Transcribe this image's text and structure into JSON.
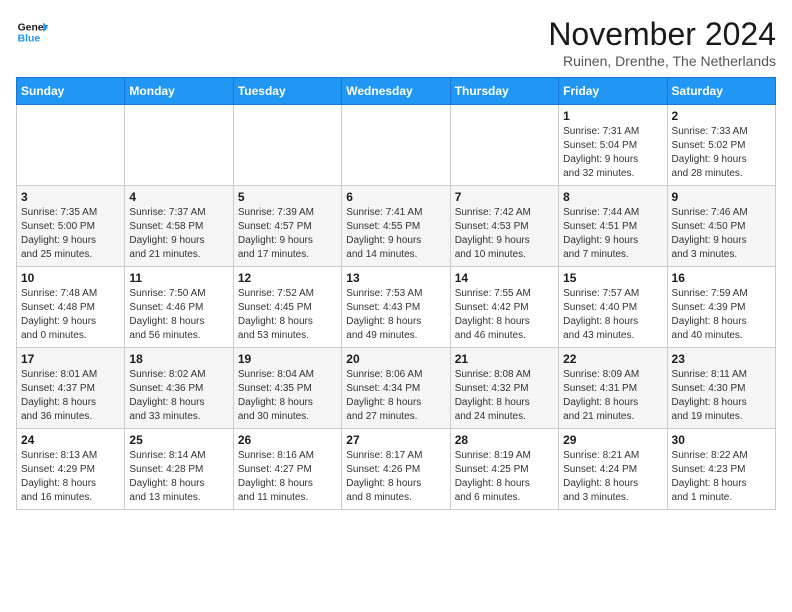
{
  "header": {
    "logo_line1": "General",
    "logo_line2": "Blue",
    "month": "November 2024",
    "location": "Ruinen, Drenthe, The Netherlands"
  },
  "weekdays": [
    "Sunday",
    "Monday",
    "Tuesday",
    "Wednesday",
    "Thursday",
    "Friday",
    "Saturday"
  ],
  "weeks": [
    [
      {
        "day": "",
        "info": ""
      },
      {
        "day": "",
        "info": ""
      },
      {
        "day": "",
        "info": ""
      },
      {
        "day": "",
        "info": ""
      },
      {
        "day": "",
        "info": ""
      },
      {
        "day": "1",
        "info": "Sunrise: 7:31 AM\nSunset: 5:04 PM\nDaylight: 9 hours\nand 32 minutes."
      },
      {
        "day": "2",
        "info": "Sunrise: 7:33 AM\nSunset: 5:02 PM\nDaylight: 9 hours\nand 28 minutes."
      }
    ],
    [
      {
        "day": "3",
        "info": "Sunrise: 7:35 AM\nSunset: 5:00 PM\nDaylight: 9 hours\nand 25 minutes."
      },
      {
        "day": "4",
        "info": "Sunrise: 7:37 AM\nSunset: 4:58 PM\nDaylight: 9 hours\nand 21 minutes."
      },
      {
        "day": "5",
        "info": "Sunrise: 7:39 AM\nSunset: 4:57 PM\nDaylight: 9 hours\nand 17 minutes."
      },
      {
        "day": "6",
        "info": "Sunrise: 7:41 AM\nSunset: 4:55 PM\nDaylight: 9 hours\nand 14 minutes."
      },
      {
        "day": "7",
        "info": "Sunrise: 7:42 AM\nSunset: 4:53 PM\nDaylight: 9 hours\nand 10 minutes."
      },
      {
        "day": "8",
        "info": "Sunrise: 7:44 AM\nSunset: 4:51 PM\nDaylight: 9 hours\nand 7 minutes."
      },
      {
        "day": "9",
        "info": "Sunrise: 7:46 AM\nSunset: 4:50 PM\nDaylight: 9 hours\nand 3 minutes."
      }
    ],
    [
      {
        "day": "10",
        "info": "Sunrise: 7:48 AM\nSunset: 4:48 PM\nDaylight: 9 hours\nand 0 minutes."
      },
      {
        "day": "11",
        "info": "Sunrise: 7:50 AM\nSunset: 4:46 PM\nDaylight: 8 hours\nand 56 minutes."
      },
      {
        "day": "12",
        "info": "Sunrise: 7:52 AM\nSunset: 4:45 PM\nDaylight: 8 hours\nand 53 minutes."
      },
      {
        "day": "13",
        "info": "Sunrise: 7:53 AM\nSunset: 4:43 PM\nDaylight: 8 hours\nand 49 minutes."
      },
      {
        "day": "14",
        "info": "Sunrise: 7:55 AM\nSunset: 4:42 PM\nDaylight: 8 hours\nand 46 minutes."
      },
      {
        "day": "15",
        "info": "Sunrise: 7:57 AM\nSunset: 4:40 PM\nDaylight: 8 hours\nand 43 minutes."
      },
      {
        "day": "16",
        "info": "Sunrise: 7:59 AM\nSunset: 4:39 PM\nDaylight: 8 hours\nand 40 minutes."
      }
    ],
    [
      {
        "day": "17",
        "info": "Sunrise: 8:01 AM\nSunset: 4:37 PM\nDaylight: 8 hours\nand 36 minutes."
      },
      {
        "day": "18",
        "info": "Sunrise: 8:02 AM\nSunset: 4:36 PM\nDaylight: 8 hours\nand 33 minutes."
      },
      {
        "day": "19",
        "info": "Sunrise: 8:04 AM\nSunset: 4:35 PM\nDaylight: 8 hours\nand 30 minutes."
      },
      {
        "day": "20",
        "info": "Sunrise: 8:06 AM\nSunset: 4:34 PM\nDaylight: 8 hours\nand 27 minutes."
      },
      {
        "day": "21",
        "info": "Sunrise: 8:08 AM\nSunset: 4:32 PM\nDaylight: 8 hours\nand 24 minutes."
      },
      {
        "day": "22",
        "info": "Sunrise: 8:09 AM\nSunset: 4:31 PM\nDaylight: 8 hours\nand 21 minutes."
      },
      {
        "day": "23",
        "info": "Sunrise: 8:11 AM\nSunset: 4:30 PM\nDaylight: 8 hours\nand 19 minutes."
      }
    ],
    [
      {
        "day": "24",
        "info": "Sunrise: 8:13 AM\nSunset: 4:29 PM\nDaylight: 8 hours\nand 16 minutes."
      },
      {
        "day": "25",
        "info": "Sunrise: 8:14 AM\nSunset: 4:28 PM\nDaylight: 8 hours\nand 13 minutes."
      },
      {
        "day": "26",
        "info": "Sunrise: 8:16 AM\nSunset: 4:27 PM\nDaylight: 8 hours\nand 11 minutes."
      },
      {
        "day": "27",
        "info": "Sunrise: 8:17 AM\nSunset: 4:26 PM\nDaylight: 8 hours\nand 8 minutes."
      },
      {
        "day": "28",
        "info": "Sunrise: 8:19 AM\nSunset: 4:25 PM\nDaylight: 8 hours\nand 6 minutes."
      },
      {
        "day": "29",
        "info": "Sunrise: 8:21 AM\nSunset: 4:24 PM\nDaylight: 8 hours\nand 3 minutes."
      },
      {
        "day": "30",
        "info": "Sunrise: 8:22 AM\nSunset: 4:23 PM\nDaylight: 8 hours\nand 1 minute."
      }
    ]
  ]
}
